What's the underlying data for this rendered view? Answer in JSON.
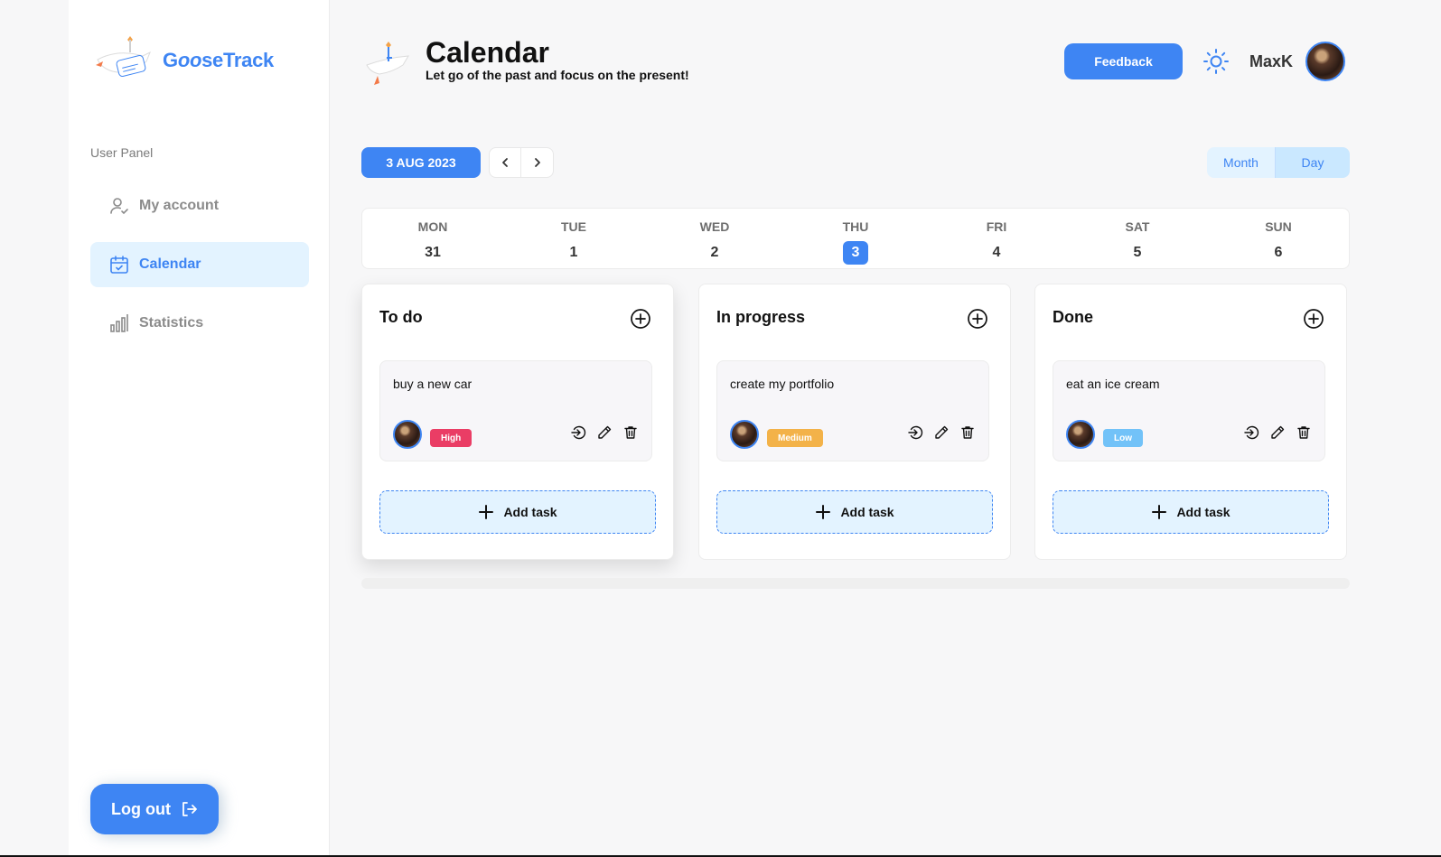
{
  "brand": {
    "name_part1": "G",
    "name_italic": "oo",
    "name_part2": "seTrack"
  },
  "sidebar": {
    "panel_label": "User Panel",
    "items": [
      {
        "label": "My account",
        "icon": "user-check-icon",
        "active": false
      },
      {
        "label": "Calendar",
        "icon": "calendar-check-icon",
        "active": true
      },
      {
        "label": "Statistics",
        "icon": "bar-chart-icon",
        "active": false
      }
    ],
    "logout_label": "Log out"
  },
  "header": {
    "title": "Calendar",
    "subtitle": "Let go of the past and focus on the present!",
    "feedback_label": "Feedback",
    "user_name": "MaxK"
  },
  "toolbar": {
    "date_label": "3 AUG 2023",
    "view_month": "Month",
    "view_day": "Day",
    "active_view": "Day"
  },
  "week": [
    {
      "name": "MON",
      "num": "31"
    },
    {
      "name": "TUE",
      "num": "1"
    },
    {
      "name": "WED",
      "num": "2"
    },
    {
      "name": "THU",
      "num": "3",
      "current": true
    },
    {
      "name": "FRI",
      "num": "4"
    },
    {
      "name": "SAT",
      "num": "5"
    },
    {
      "name": "SUN",
      "num": "6"
    }
  ],
  "columns": [
    {
      "title": "To do",
      "task": {
        "text": "buy a new car",
        "priority": "High",
        "priority_color": "#ea3d65"
      },
      "add_label": "Add task"
    },
    {
      "title": "In progress",
      "task": {
        "text": "create my portfolio",
        "priority": "Medium",
        "priority_color": "#f3b249"
      },
      "add_label": "Add task"
    },
    {
      "title": "Done",
      "task": {
        "text": "eat an ice cream",
        "priority": "Low",
        "priority_color": "#72c2f8"
      },
      "add_label": "Add task"
    }
  ],
  "colors": {
    "accent": "#3e85f3",
    "accent_light": "#e3f3ff"
  }
}
